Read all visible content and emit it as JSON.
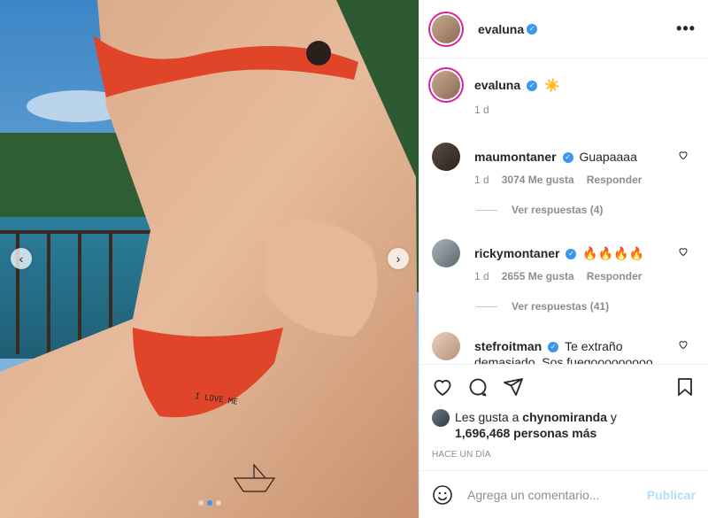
{
  "post": {
    "author": "evaluna",
    "verified": true,
    "more_icon": "more-horizontal-icon"
  },
  "media": {
    "prev_icon": "chevron-left-icon",
    "next_icon": "chevron-right-icon",
    "carousel_total": 3,
    "carousel_active": 2,
    "tattoo_text": "I LOVE ME"
  },
  "caption": {
    "username": "evaluna",
    "emoji": "☀️",
    "time": "1 d"
  },
  "comments": [
    {
      "username": "maumontaner",
      "text": "Guapaaaa",
      "time": "1 d",
      "likes": "3074 Me gusta",
      "reply": "Responder",
      "view_replies": "Ver respuestas (4)"
    },
    {
      "username": "rickymontaner",
      "text": "🔥🔥🔥🔥",
      "time": "1 d",
      "likes": "2655 Me gusta",
      "reply": "Responder",
      "view_replies": "Ver respuestas (41)"
    },
    {
      "username": "stefroitman",
      "text": "Te extraño demasiado. Sos fuegooooooooo 🔥"
    }
  ],
  "actions": {
    "like_icon": "heart-icon",
    "comment_icon": "comment-icon",
    "share_icon": "send-icon",
    "save_icon": "bookmark-icon"
  },
  "likes": {
    "prefix": "Les gusta a",
    "first_user": "chynomiranda",
    "connector": "y",
    "others": "1,696,468 personas más"
  },
  "timestamp": "HACE UN DÍA",
  "add_comment": {
    "emoji_icon": "emoji-smile-icon",
    "placeholder": "Agrega un comentario...",
    "publish_label": "Publicar"
  },
  "colors": {
    "accent": "#3897f0",
    "publish_disabled": "#b2dffc",
    "muted_text": "#8e8e8e",
    "border": "#efefef"
  }
}
